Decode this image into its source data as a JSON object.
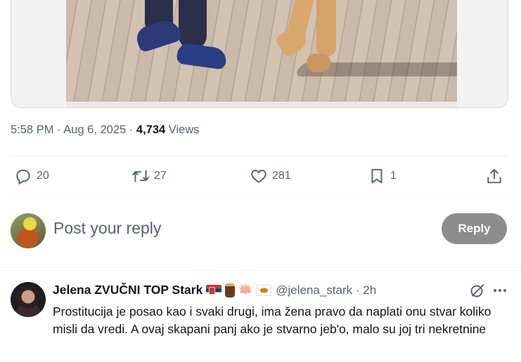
{
  "media": {
    "alt": ""
  },
  "tweet_meta": {
    "time": "5:58 PM",
    "sep1": " · ",
    "date": "Aug 6, 2025",
    "sep2": " · ",
    "views_count": "4,734",
    "views_label": "Views"
  },
  "actions": {
    "replies": "20",
    "reposts": "27",
    "likes": "281",
    "bookmarks": "1"
  },
  "reply_box": {
    "placeholder": "Post your reply",
    "button_label": "Reply"
  },
  "reply": {
    "name": "Jelena ZVUČNI TOP Stark",
    "handle": "@jelena_stark",
    "time_sep": " · ",
    "time": "2h",
    "text": "Prostitucija je posao kao i svaki drugi, ima žena pravo da naplati onu stvar koliko misli da vredi. A ovaj skapani panj ako je stvarno jeb'o, malo su joj tri nekretnine",
    "emoji_lotus": "🪷"
  },
  "colors": {
    "secondary_text": "#536471",
    "reply_button_bg": "#8c8c8c",
    "divider": "#eff3f4"
  }
}
